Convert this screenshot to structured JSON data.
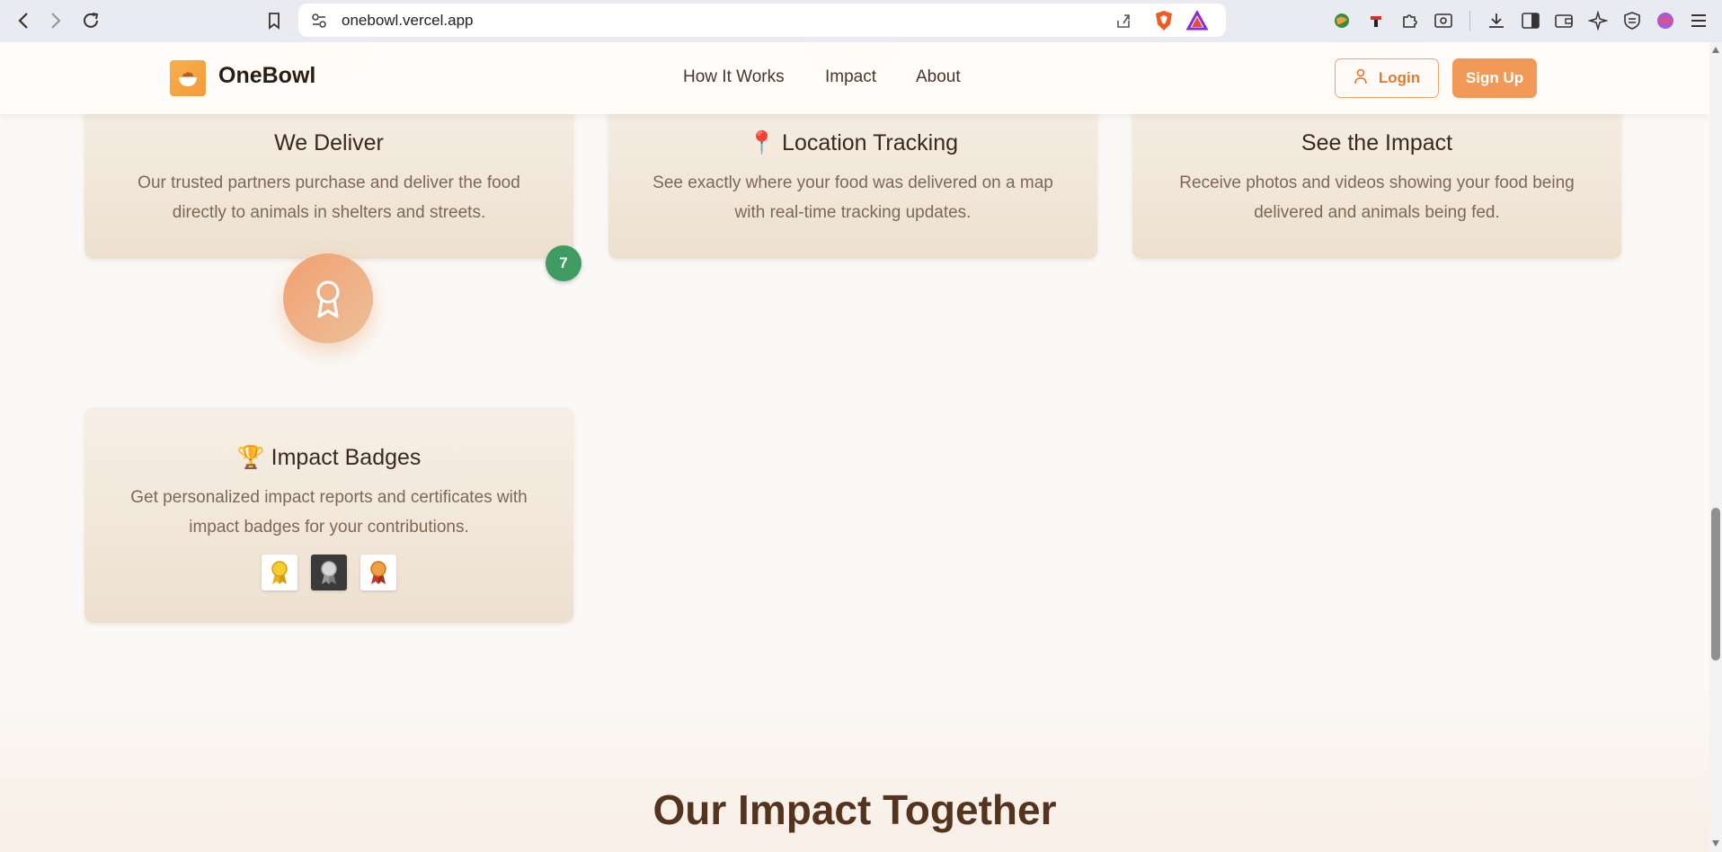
{
  "browser": {
    "url": "onebowl.vercel.app"
  },
  "header": {
    "brand": "OneBowl",
    "nav": [
      "How It Works",
      "Impact",
      "About"
    ],
    "login_label": "Login",
    "signup_label": "Sign Up"
  },
  "cards": [
    {
      "title": "We Deliver",
      "desc_line1": "Our trusted partners purchase and deliver the food",
      "desc_line2": "directly to animals in shelters and streets."
    },
    {
      "title": "📍 Location Tracking",
      "desc_line1": "See exactly where your food was delivered on a map",
      "desc_line2": "with real-time tracking updates."
    },
    {
      "title": "See the Impact",
      "desc_line1": "Receive photos and videos showing your food being",
      "desc_line2": "delivered and animals being fed."
    },
    {
      "title": "🏆 Impact Badges",
      "desc_line1": "Get personalized impact reports and certificates with",
      "desc_line2": "impact badges for your contributions.",
      "step": "7"
    }
  ],
  "medals": [
    "🎗",
    "🥈",
    "🏅"
  ],
  "section": {
    "title": "Our Impact Together"
  },
  "colors": {
    "accent": "#f19a57",
    "step_badge": "#3e9b62",
    "heading": "#55341f"
  }
}
